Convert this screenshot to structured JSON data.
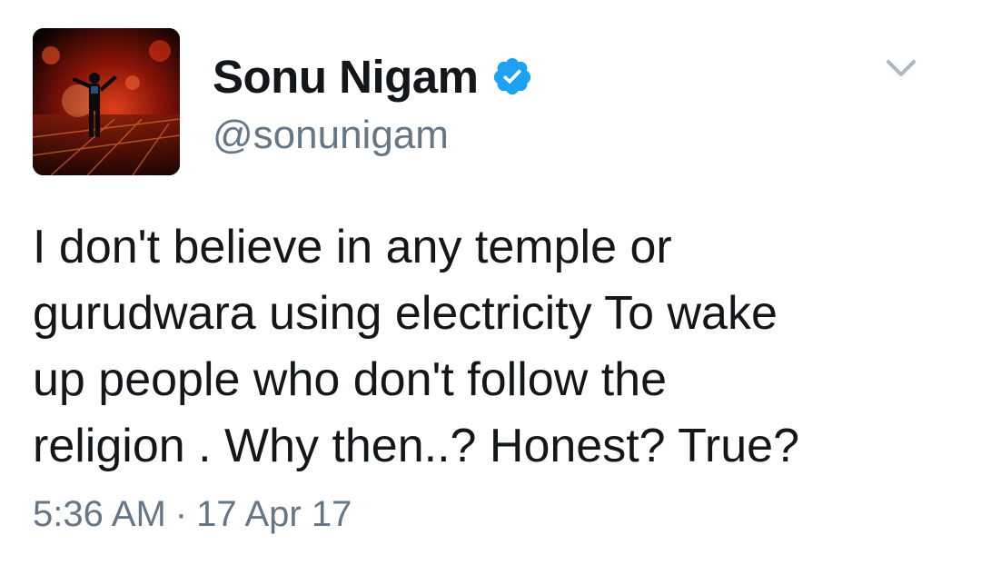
{
  "tweet": {
    "display_name": "Sonu Nigam",
    "handle": "@sonunigam",
    "verified": true,
    "verified_icon": "verified-badge-icon",
    "menu_icon": "chevron-down-icon",
    "text": "I don't believe in any temple or\ngurudwara using electricity To wake\nup people who don't follow the\nreligion . Why then..? Honest? True?",
    "time": "5:36 AM",
    "separator": "·",
    "date": "17 Apr 17"
  },
  "colors": {
    "text": "#14171a",
    "secondary": "#657786",
    "verified_blue": "#1da1f2",
    "background": "#ffffff"
  }
}
